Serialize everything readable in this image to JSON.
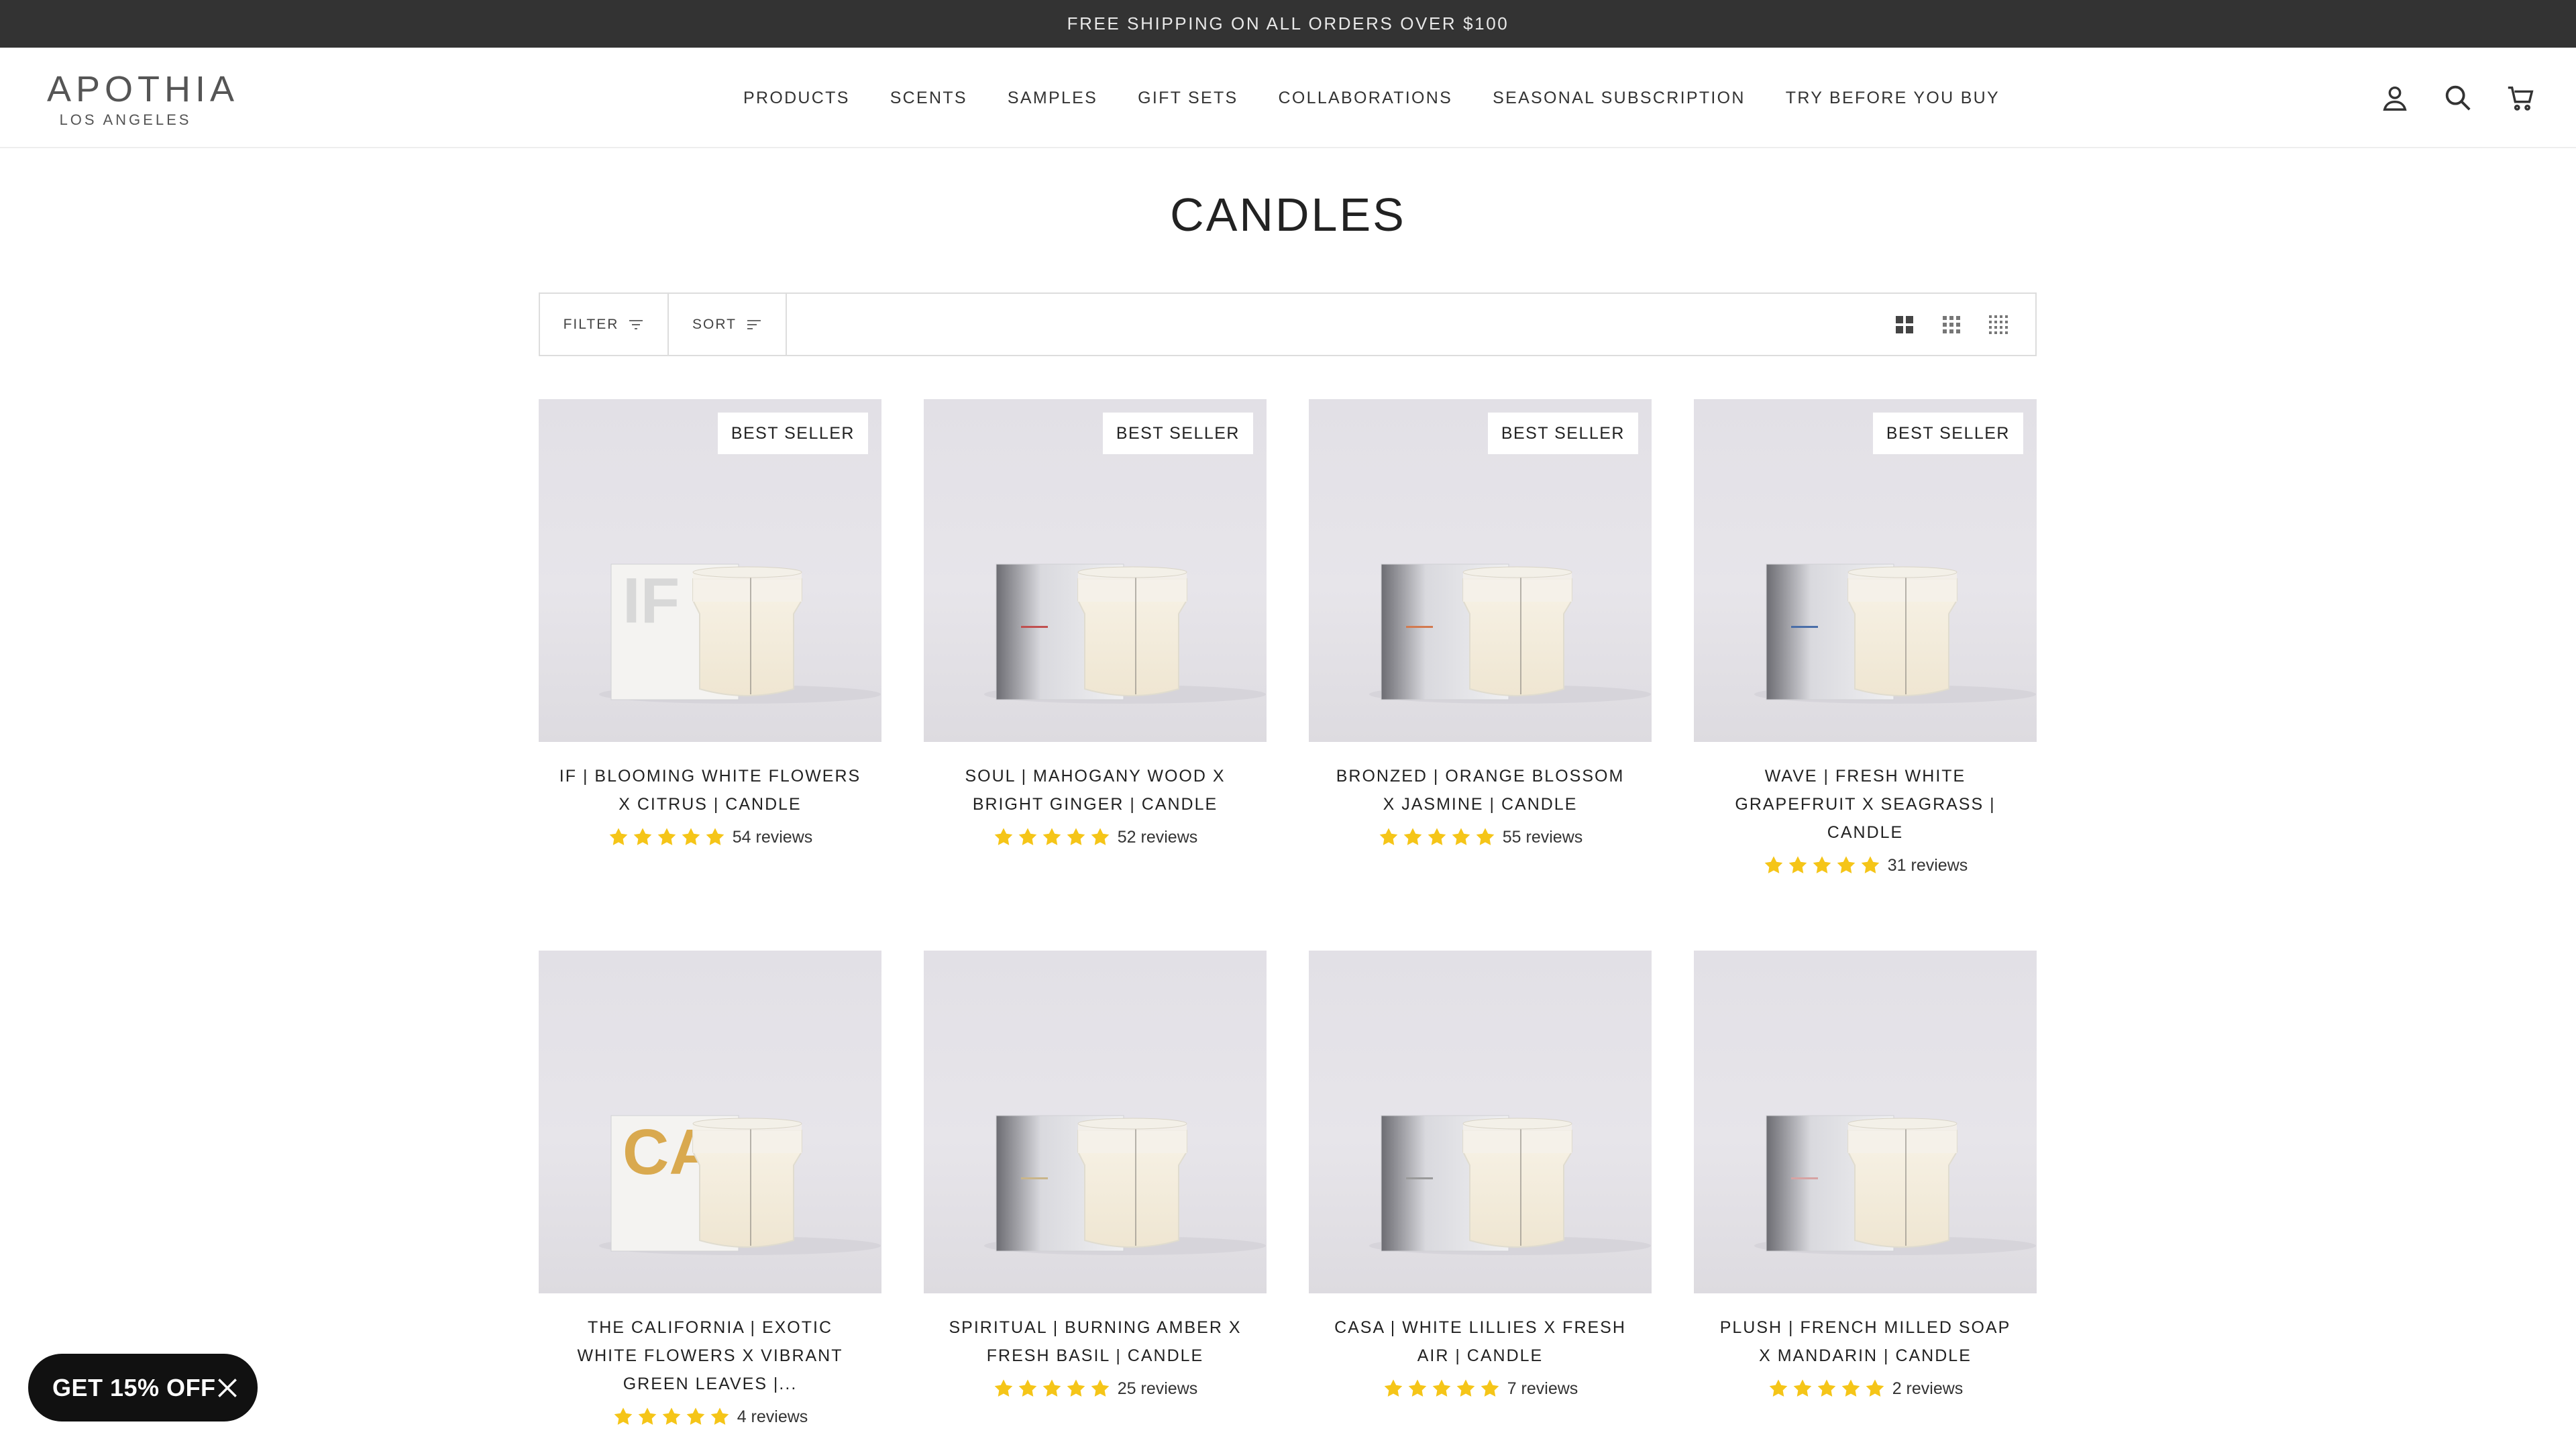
{
  "announcement": "FREE SHIPPING ON ALL ORDERS OVER $100",
  "brand": {
    "name": "APOTHIA",
    "tagline": "LOS ANGELES"
  },
  "nav": [
    "PRODUCTS",
    "SCENTS",
    "SAMPLES",
    "GIFT SETS",
    "COLLABORATIONS",
    "SEASONAL SUBSCRIPTION",
    "TRY BEFORE YOU BUY"
  ],
  "header_icons": [
    "account-icon",
    "search-icon",
    "cart-icon"
  ],
  "page_title": "CANDLES",
  "toolbar": {
    "filter_label": "FILTER",
    "sort_label": "SORT",
    "view_icons": [
      "grid-large-icon",
      "grid-medium-icon",
      "grid-small-icon"
    ]
  },
  "products": [
    {
      "title": "IF | BLOOMING WHITE FLOWERS X CITRUS | CANDLE",
      "badge": "BEST SELLER",
      "rating": 5,
      "reviews": "54 reviews",
      "box_label": "IF",
      "box_label_color": "#d8d8d8"
    },
    {
      "title": "SOUL | MAHOGANY WOOD X BRIGHT GINGER | CANDLE",
      "badge": "BEST SELLER",
      "rating": 5,
      "reviews": "52 reviews",
      "box_label": "",
      "box_label_color": "#c05050"
    },
    {
      "title": "BRONZED | ORANGE BLOSSOM X JASMINE | CANDLE",
      "badge": "BEST SELLER",
      "rating": 5,
      "reviews": "55 reviews",
      "box_label": "",
      "box_label_color": "#d27a50"
    },
    {
      "title": "WAVE | FRESH WHITE GRAPEFRUIT X SEAGRASS | CANDLE",
      "badge": "BEST SELLER",
      "rating": 5,
      "reviews": "31 reviews",
      "box_label": "",
      "box_label_color": "#4a6ea8"
    },
    {
      "title": "THE CALIFORNIA | EXOTIC WHITE FLOWERS X VIBRANT GREEN LEAVES |...",
      "badge": "",
      "rating": 5,
      "reviews": "4 reviews",
      "box_label": "CA",
      "box_label_color": "#d9a94f"
    },
    {
      "title": "SPIRITUAL | BURNING AMBER X FRESH BASIL | CANDLE",
      "badge": "",
      "rating": 5,
      "reviews": "25 reviews",
      "box_label": "",
      "box_label_color": "#c9b58a"
    },
    {
      "title": "CASA | WHITE LILLIES X FRESH AIR | CANDLE",
      "badge": "",
      "rating": 5,
      "reviews": "7 reviews",
      "box_label": "",
      "box_label_color": "#9a9a9a"
    },
    {
      "title": "PLUSH | FRENCH MILLED SOAP X MANDARIN | CANDLE",
      "badge": "",
      "rating": 5,
      "reviews": "2 reviews",
      "box_label": "",
      "box_label_color": "#d6a3a3"
    }
  ],
  "discount_popup": {
    "label": "GET 15% OFF"
  },
  "colors": {
    "announcement_bg": "#333333",
    "star": "#f5c518",
    "pill_bg": "#111111"
  }
}
